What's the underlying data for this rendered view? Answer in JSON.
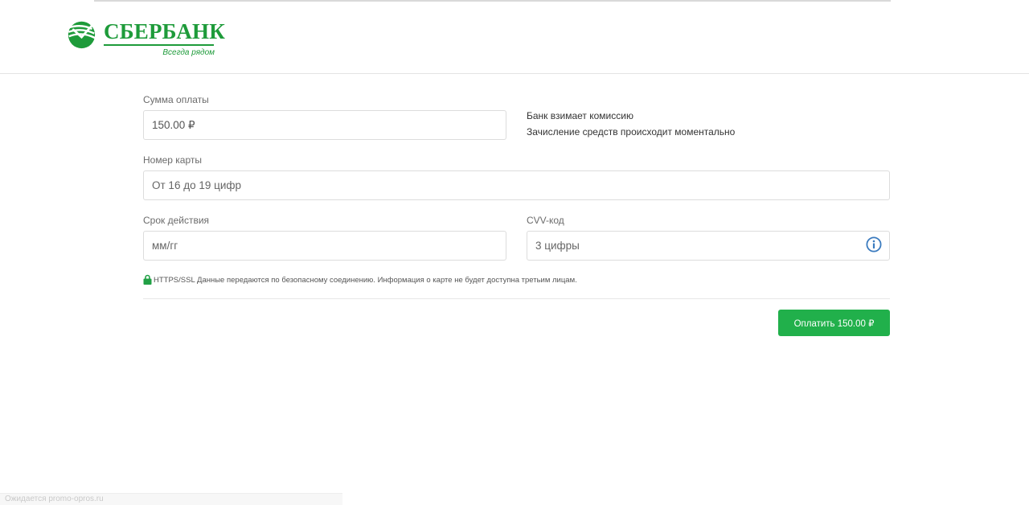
{
  "header": {
    "brand_name": "СБЕРБАНК",
    "slogan": "Всегда рядом",
    "brand_color": "#1e9b3a"
  },
  "form": {
    "amount": {
      "label": "Сумма оплаты",
      "value": "150.00 ₽"
    },
    "info": {
      "line1": "Банк взимает комиссию",
      "line2": "Зачисление средств происходит моментально"
    },
    "card_number": {
      "label": "Номер карты",
      "placeholder": "От 16 до 19 цифр"
    },
    "expiry": {
      "label": "Срок действия",
      "placeholder": "мм/гг"
    },
    "cvv": {
      "label": "CVV-код",
      "placeholder": "3 цифры",
      "icon": "info-icon"
    },
    "ssl_notice": "HTTPS/SSL Данные передаются по безопасному соединению. Информация о карте не будет доступна третьим лицам.",
    "pay_button": "Оплатить 150.00 ₽",
    "button_color": "#21b04b"
  },
  "statusbar": {
    "text": "Ожидается promo-opros.ru"
  }
}
